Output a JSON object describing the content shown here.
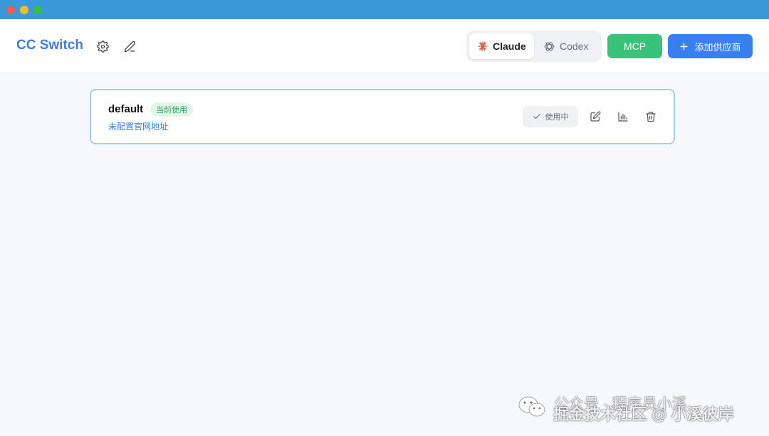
{
  "window": {
    "traffic_lights": [
      "close",
      "minimize",
      "zoom"
    ],
    "titlebar_color": "#3a9ad9"
  },
  "header": {
    "app_title": "CC Switch",
    "settings_icon": "gear-icon",
    "edit_icon": "pencil-icon",
    "app_switcher": {
      "selected": "Claude",
      "options": [
        {
          "label": "Claude",
          "icon": "claude-spark-icon"
        },
        {
          "label": "Codex",
          "icon": "openai-icon"
        }
      ]
    },
    "mcp_button": "MCP",
    "add_provider_button": "添加供应商"
  },
  "providers": [
    {
      "name": "default",
      "badge": "当前使用",
      "website": "未配置官网地址",
      "status_button": "使用中",
      "actions": [
        "edit-icon",
        "stats-icon",
        "trash-icon"
      ]
    }
  ],
  "watermark": {
    "line1": "公众号 · 程序员小溪",
    "line2": "掘金技术社区 @ 小溪彼岸"
  },
  "colors": {
    "brand": "#3c7fdc",
    "mcp": "#39c27a",
    "primary": "#3a7ff2",
    "badge_bg": "#e4f6e9",
    "badge_text": "#2fa75a",
    "card_border": "#a9cbf2"
  }
}
